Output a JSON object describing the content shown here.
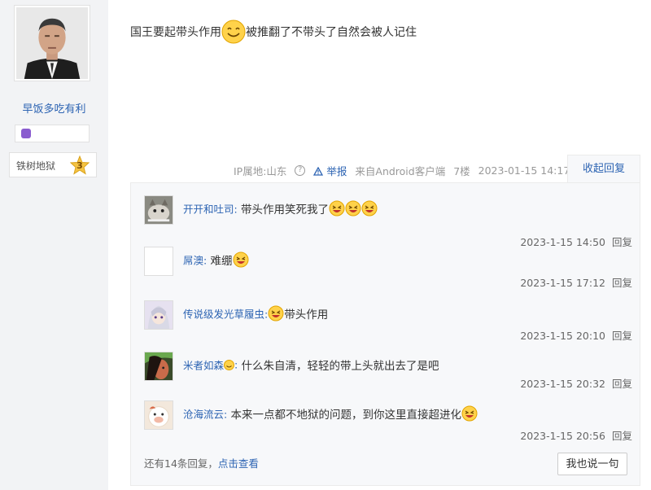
{
  "author": {
    "username": "早饭多吃有利",
    "level_title": "铁树地狱",
    "level_number": "3"
  },
  "post": {
    "text_before": "国王要起带头作用",
    "text_after": "被推翻了不带头了自然会被人记住"
  },
  "meta": {
    "ip_location": "IP属地:山东",
    "report_label": "举报",
    "source": "来自Android客户端",
    "floor": "7楼",
    "timestamp": "2023-01-15 14:17",
    "fold_label": "收起回复"
  },
  "replies": [
    {
      "name": "开开和吐司:",
      "text": "带头作用笑死我了",
      "time": "2023-1-15 14:50",
      "reply_label": "回复"
    },
    {
      "name": "屌澳:",
      "text": "难绷",
      "time": "2023-1-15 17:12",
      "reply_label": "回复"
    },
    {
      "name": "传说级发光草履虫:",
      "text": "带头作用",
      "time": "2023-1-15 20:10",
      "reply_label": "回复"
    },
    {
      "name": "米者如森",
      "name_suffix": ":",
      "text": "什么朱自清，轻轻的带上头就出去了是吧",
      "time": "2023-1-15 20:32",
      "reply_label": "回复"
    },
    {
      "name": "沧海流云:",
      "text": "本来一点都不地狱的问题，到你这里直接超进化",
      "time": "2023-1-15 20:56",
      "reply_label": "回复"
    }
  ],
  "footer": {
    "more_prefix": "还有14条回复，",
    "more_link": "点击查看",
    "say_button": "我也说一句"
  }
}
